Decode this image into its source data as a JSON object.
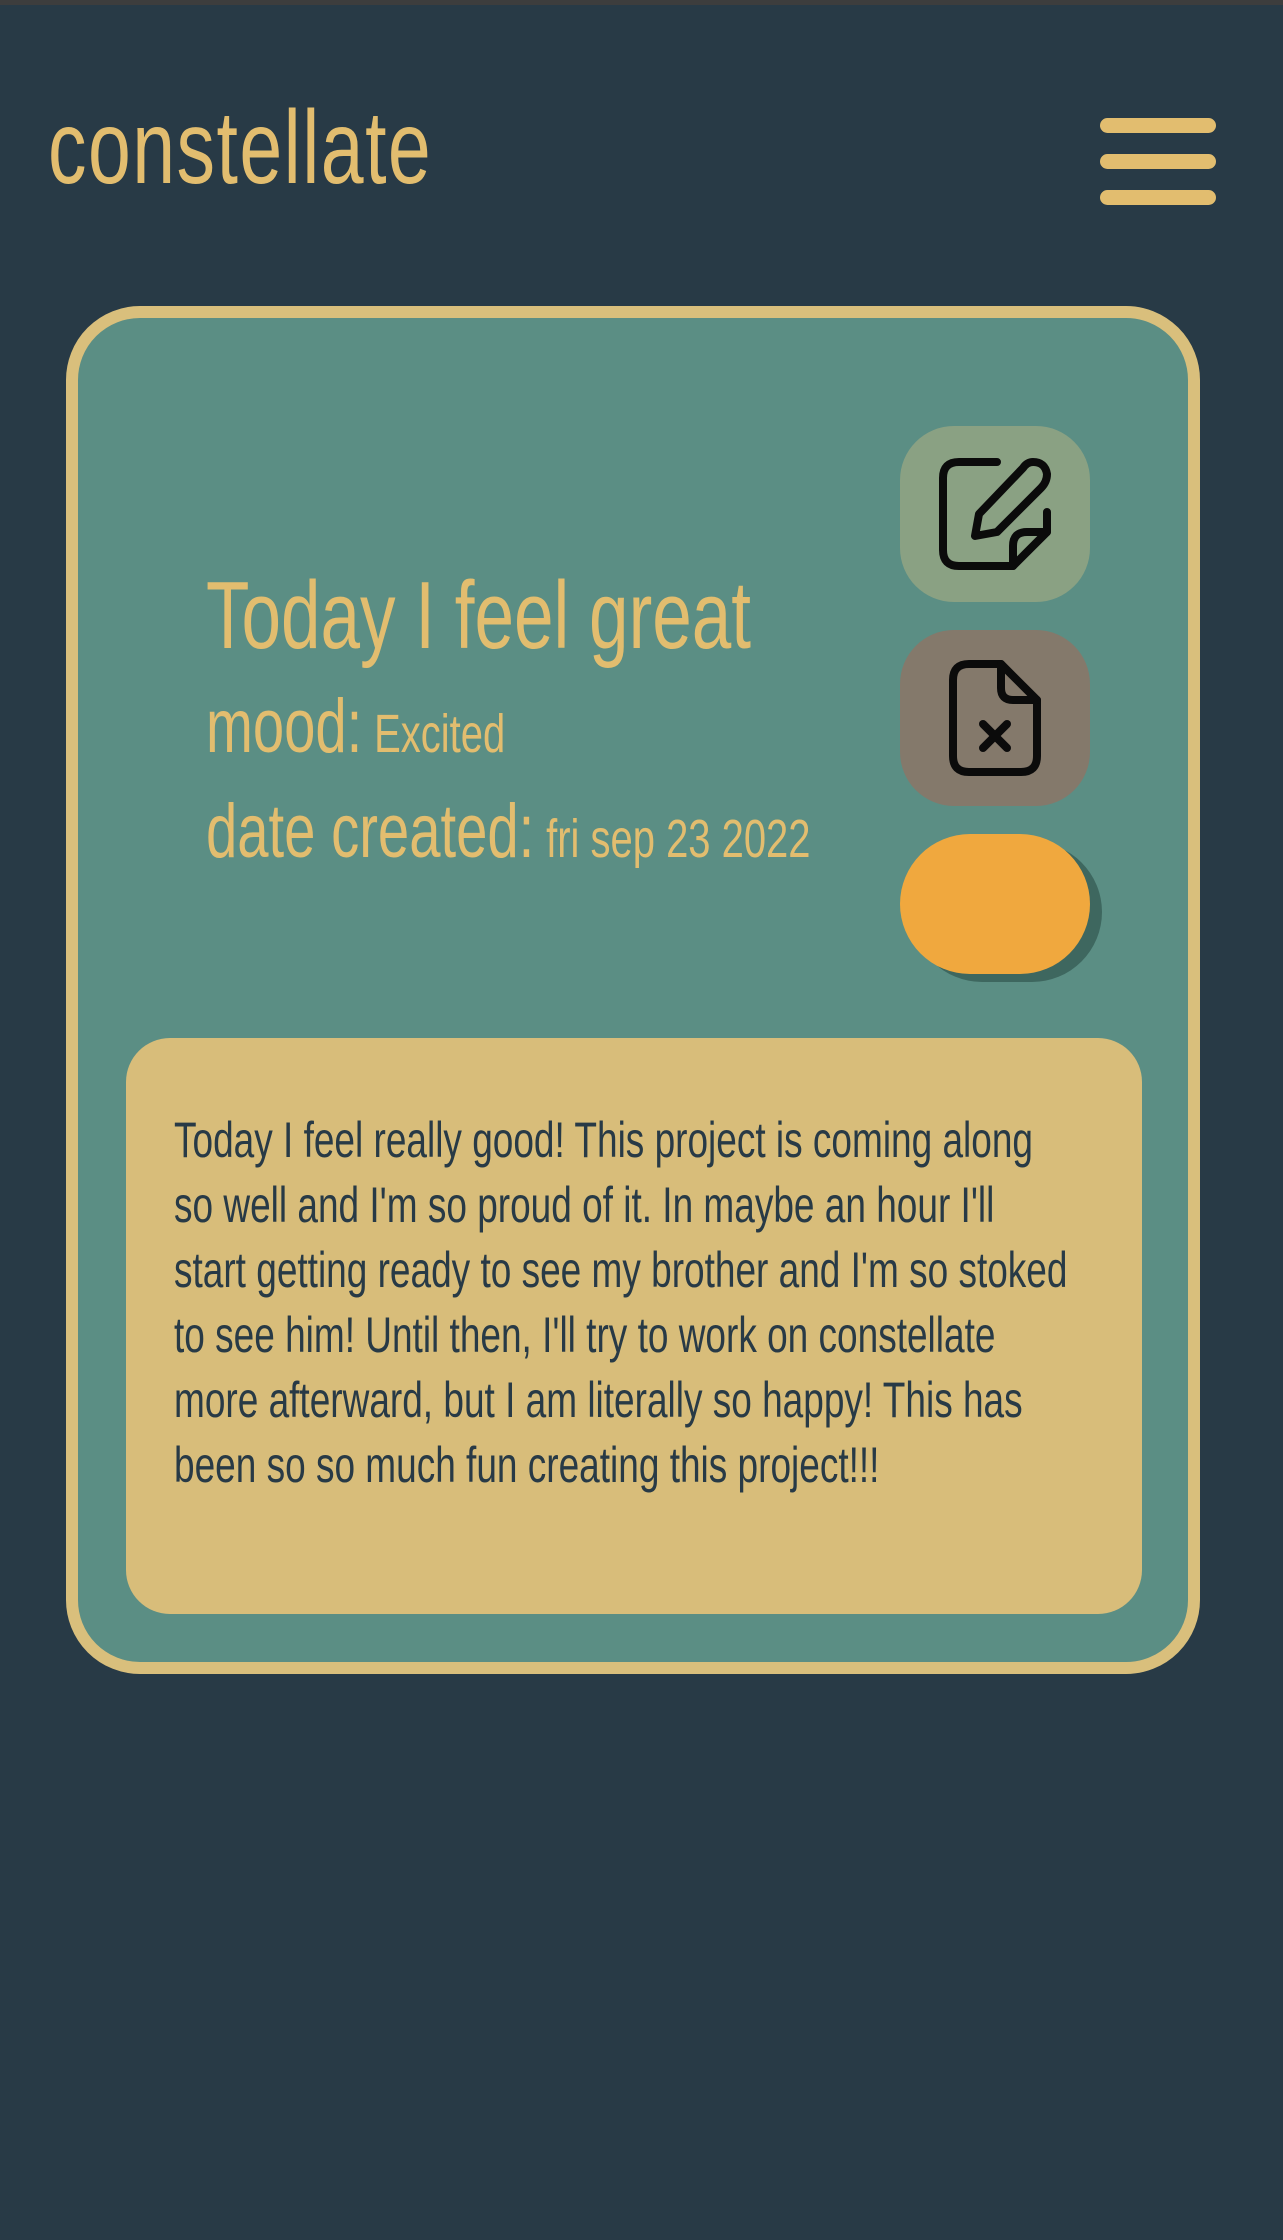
{
  "app": {
    "title": "constellate"
  },
  "header": {
    "menu_icon": "hamburger-menu-icon"
  },
  "entry": {
    "title": "Today I feel great",
    "mood_label": "mood:",
    "mood_value": "Excited",
    "date_label": "date created:",
    "date_value": "fri sep 23 2022",
    "body": "Today I feel really good! This project is coming along so well and I'm so proud of it. In maybe an hour I'll start getting ready to see my brother and I'm so stoked to see him! Until then, I'll try to work on constellate more afterward, but I am literally so happy! This has been so so much fun creating this project!!!"
  },
  "actions": {
    "edit_icon": "edit-icon",
    "delete_icon": "file-x-icon"
  },
  "colors": {
    "background": "#283a46",
    "accent": "#e2bd6f",
    "card": "#5b8e84",
    "card_border": "#d9bf7c",
    "body_panel": "#d8bd7a",
    "edit_button": "#8aa183",
    "delete_button": "#84796b",
    "toggle_button": "#f0a83e"
  }
}
